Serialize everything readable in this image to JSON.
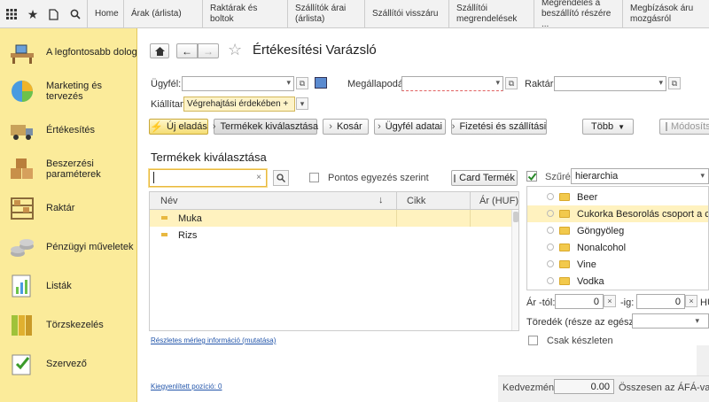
{
  "topbar": {
    "tabs": [
      {
        "label": "Home"
      },
      {
        "label": "Árak (árlista)"
      },
      {
        "label": "Raktárak és boltok"
      },
      {
        "label": "Szállítók árai (árlista)"
      },
      {
        "label": "Szállítói visszáru"
      },
      {
        "label": "Szállítói megrendelések"
      },
      {
        "label": "Megrendelés a beszállító részére ..."
      },
      {
        "label": "Megbízások áru mozgásról"
      }
    ]
  },
  "sidebar": {
    "items": [
      {
        "label": "A legfontosabb dolog",
        "icon": "desk-icon"
      },
      {
        "label": "Marketing és tervezés",
        "icon": "pie-chart-icon"
      },
      {
        "label": "Értékesítés",
        "icon": "delivery-truck-icon"
      },
      {
        "label": "Beszerzési paraméterek",
        "icon": "boxes-icon"
      },
      {
        "label": "Raktár",
        "icon": "warehouse-icon"
      },
      {
        "label": "Pénzügyi műveletek",
        "icon": "coins-icon"
      },
      {
        "label": "Listák",
        "icon": "chart-report-icon"
      },
      {
        "label": "Törzskezelés",
        "icon": "binders-icon"
      },
      {
        "label": "Szervező",
        "icon": "organizer-icon"
      }
    ]
  },
  "header": {
    "title": "Értékesítési Varázsló"
  },
  "form": {
    "customer_label": "Ügyfél:",
    "agreement_label": "Megállapodás:",
    "warehouse_label": "Raktár:",
    "issue_label": "Kiállítani:",
    "issue_value": "Végrehajtási érdekében +"
  },
  "toolbar": {
    "new_sale": "Új eladás",
    "select_products": "Termékek kiválasztása",
    "cart": "Kosár",
    "customer_data": "Ügyfél adatai",
    "payment": "Fizetési és szállítási",
    "more": "Több",
    "modify": "Módosítsa"
  },
  "section": {
    "title": "Termékek kiválasztása"
  },
  "search": {
    "value": "",
    "exact_match_label": "Pontos egyezés szerint",
    "card_button": "Card Termék"
  },
  "table": {
    "columns": [
      "Név",
      "Cikk",
      "Ár (HUF)"
    ],
    "rows": [
      {
        "name": "Muka",
        "selected": true
      },
      {
        "name": "Rizs",
        "selected": false
      }
    ]
  },
  "links": {
    "balance_info": "Részletes mérleg információ (mutatása)",
    "selected_positions": "Kiegyenlített pozíció: 0"
  },
  "filter": {
    "label": "Szűrés",
    "mode": "hierarchia",
    "checked": true,
    "tree": [
      {
        "label": "Beer",
        "selected": false
      },
      {
        "label": "Cukorka Besorolás csoport a cikk felvitele",
        "selected": true
      },
      {
        "label": "Göngyöleg",
        "selected": false
      },
      {
        "label": "Nonalcohol",
        "selected": false
      },
      {
        "label": "Vine",
        "selected": false
      },
      {
        "label": "Vodka",
        "selected": false
      }
    ],
    "price_from_label": "Ár -tól:",
    "price_from": "0",
    "price_to_label": "-ig:",
    "price_to": "0",
    "currency": "HUF",
    "fraction_label": "Töredék (része az egésznek):",
    "in_stock_label": "Csak készleten"
  },
  "footer": {
    "discount_label": "Kedvezmény:",
    "discount_value": "0.00",
    "total_label": "Összesen az ÁFÁ-val:"
  }
}
